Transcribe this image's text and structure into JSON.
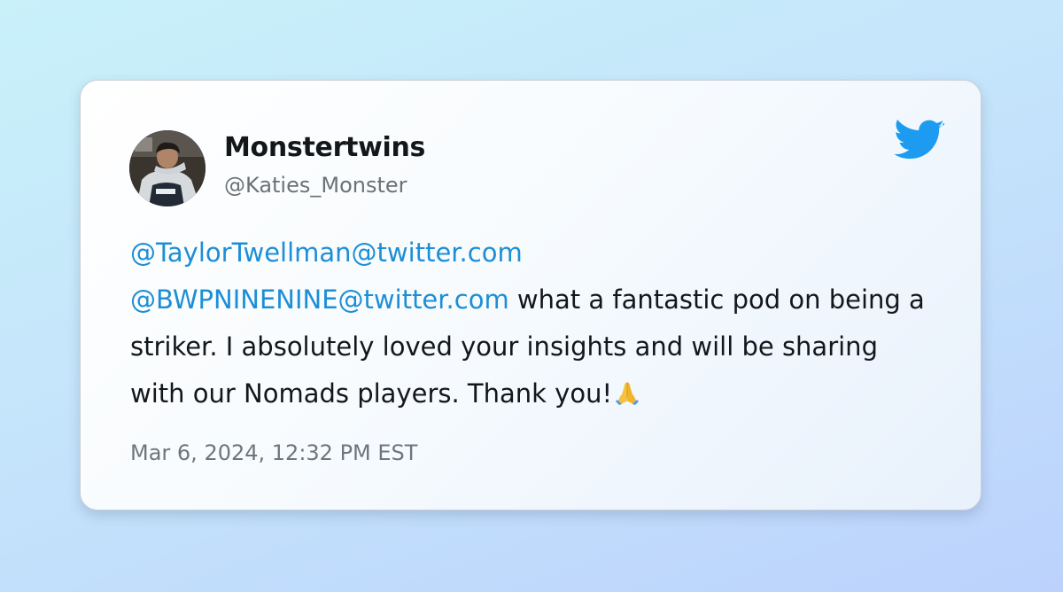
{
  "tweet": {
    "author": {
      "display_name": "Monstertwins",
      "handle": "@Katies_Monster",
      "avatar_icon": "profile-photo"
    },
    "platform_icon": "twitter-bird-icon",
    "mentions": [
      "@TaylorTwellman@twitter.com",
      "@BWPNINENINE@twitter.com"
    ],
    "body_text": " what a fantastic pod on being a striker. I absolutely loved your insights and will be sharing with our Nomads players. Thank you!",
    "emoji_icon": "folded-hands-emoji",
    "timestamp": "Mar 6, 2024, 12:32 PM EST"
  },
  "colors": {
    "mention": "#1d8ed6",
    "twitter_blue": "#1d9bf0",
    "text": "#14171a",
    "muted": "#6e767d"
  }
}
